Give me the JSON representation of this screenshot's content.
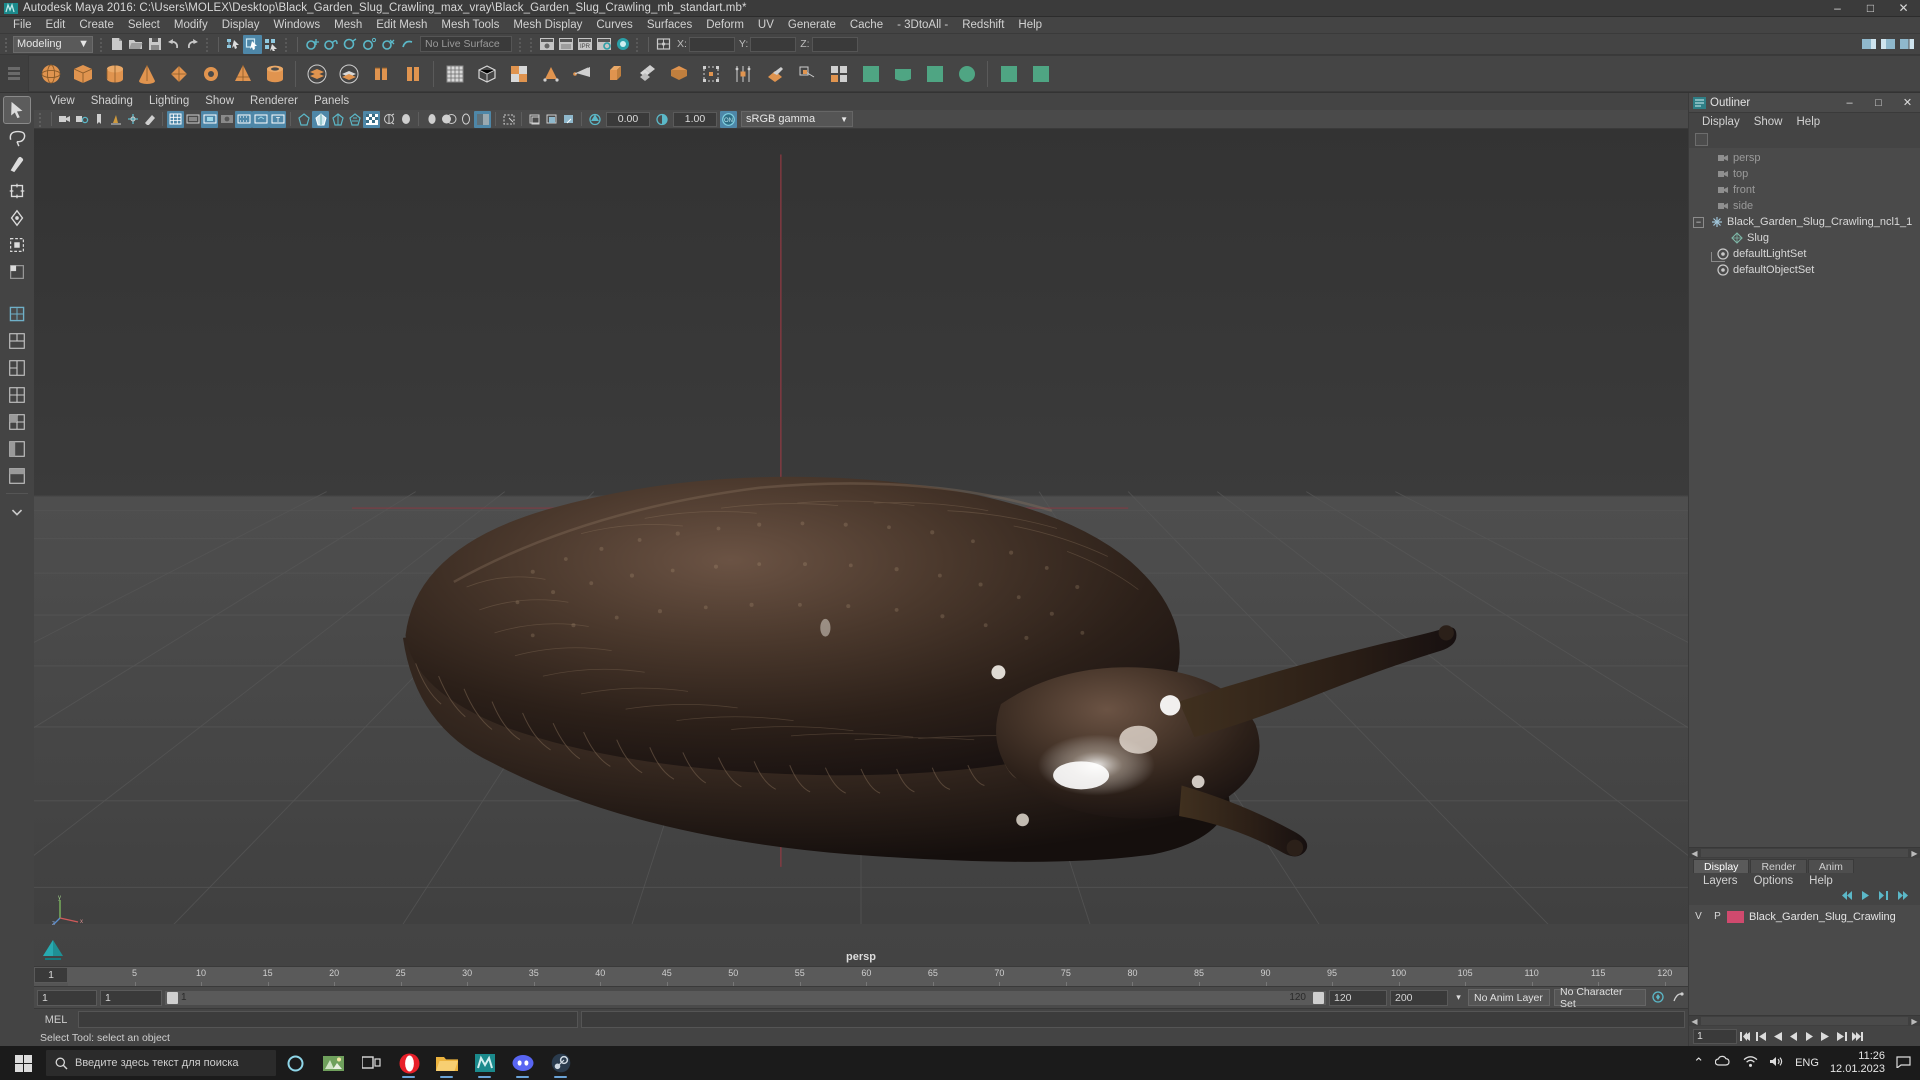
{
  "window": {
    "title": "Autodesk Maya 2016: C:\\Users\\MOLEX\\Desktop\\Black_Garden_Slug_Crawling_max_vray\\Black_Garden_Slug_Crawling_mb_standart.mb*",
    "app_icon": "maya-icon",
    "minimize": "–",
    "maximize": "□",
    "close": "✕"
  },
  "menubar": {
    "items": [
      "File",
      "Edit",
      "Create",
      "Select",
      "Modify",
      "Display",
      "Windows",
      "Mesh",
      "Edit Mesh",
      "Mesh Tools",
      "Mesh Display",
      "Curves",
      "Surfaces",
      "Deform",
      "UV",
      "Generate",
      "Cache",
      "- 3DtoAll -",
      "Redshift",
      "Help"
    ]
  },
  "statusline": {
    "mode": "Modeling",
    "mode_caret": "▼",
    "live_surface": "No Live Surface",
    "coord_x_label": "X:",
    "coord_y_label": "Y:",
    "coord_z_label": "Z:",
    "coord_x_value": "",
    "coord_y_value": "",
    "coord_z_value": "",
    "icons": [
      "new-scene-icon",
      "open-scene-icon",
      "save-scene-icon",
      "undo-icon",
      "redo-icon",
      "select-by-hierarchy-icon",
      "select-by-object-icon",
      "select-by-component-icon",
      "snap-to-grid-icon",
      "snap-to-curve-icon",
      "snap-to-point-icon",
      "snap-to-projected-center-icon",
      "snap-to-view-plane-icon",
      "make-live-icon",
      "show-render-view-icon",
      "render-current-frame-icon",
      "ipr-render-icon",
      "render-settings-icon",
      "hypershade-icon",
      "toggle-editors-icon"
    ]
  },
  "shelf": {
    "active_tab": "Polygons",
    "items": [
      "poly-sphere-icon",
      "poly-cube-icon",
      "poly-cylinder-icon",
      "poly-cone-icon",
      "poly-plane-icon",
      "poly-torus-icon",
      "poly-prism-icon",
      "poly-pipe-icon",
      "poly-helix-icon",
      "poly-soccer-ball-icon",
      "poly-platonic-icon",
      "poly-pyramid-icon",
      "combine-icon",
      "separate-icon",
      "booleans-icon",
      "smooth-icon",
      "mirror-icon",
      "extrude-icon",
      "bevel-icon",
      "bridge-icon",
      "append-polygon-icon",
      "wedge-icon",
      "duplicate-face-icon",
      "connect-icon",
      "detach-icon",
      "multi-cut-icon",
      "target-weld-icon",
      "quad-draw-icon",
      "sculpt-icon",
      "create-uvs-icon",
      "uv-editor-icon"
    ]
  },
  "toolbox": {
    "items": [
      {
        "name": "select-tool-icon",
        "selected": true
      },
      {
        "name": "lasso-select-tool-icon",
        "selected": false
      },
      {
        "name": "paint-select-tool-icon",
        "selected": false
      },
      {
        "name": "move-tool-icon",
        "selected": false
      },
      {
        "name": "rotate-tool-icon",
        "selected": false
      },
      {
        "name": "scale-tool-icon",
        "selected": false
      },
      {
        "name": "last-tool-icon",
        "selected": false
      },
      {
        "name": "single-pane-layout-icon",
        "selected": false
      },
      {
        "name": "two-pane-side-layout-icon",
        "selected": false
      },
      {
        "name": "two-pane-stacked-layout-icon",
        "selected": false
      },
      {
        "name": "three-pane-layout-icon",
        "selected": false
      },
      {
        "name": "four-pane-layout-icon",
        "selected": false
      },
      {
        "name": "persp-outliner-layout-icon",
        "selected": false
      },
      {
        "name": "hypershade-layout-icon",
        "selected": false
      },
      {
        "name": "more-layouts-icon",
        "selected": false
      }
    ]
  },
  "viewport": {
    "panel_menu": [
      "View",
      "Shading",
      "Lighting",
      "Show",
      "Renderer",
      "Panels"
    ],
    "camera_label": "persp",
    "toolbar": {
      "exposure_value": "0.00",
      "gamma_value": "1.00",
      "color_space": "sRGB gamma",
      "color_space_caret": "▼",
      "color_toggle": "ON",
      "icons": [
        "select-camera-icon",
        "camera-attributes-icon",
        "bookmarks-icon",
        "image-plane-icon",
        "two-d-pan-zoom-icon",
        "grease-pencil-icon",
        "grid-icon",
        "film-gate-icon",
        "resolution-gate-icon",
        "gate-mask-icon",
        "film-origin-icon",
        "safe-action-icon",
        "field-chart-icon",
        "wireframe-icon",
        "smooth-shade-icon",
        "shaded-wireframe-icon",
        "textured-icon",
        "use-default-lighting-icon",
        "shadows-icon",
        "ambient-occlusion-icon",
        "motion-blur-icon",
        "multisample-icon",
        "depth-of-field-icon",
        "isolate-select-icon",
        "xray-icon",
        "xray-joints-icon",
        "xray-active-components-icon",
        "exposure-icon",
        "gamma-icon"
      ]
    },
    "axis_labels": {
      "y": "y",
      "x": "x",
      "z": "z"
    }
  },
  "outliner": {
    "title": "Outliner",
    "title_icon": "outliner-icon",
    "minimize": "–",
    "maximize": "□",
    "close": "✕",
    "menu": [
      "Display",
      "Show",
      "Help"
    ],
    "items": [
      {
        "label": "persp",
        "icon": "camera-icon",
        "indent": 24,
        "dim": true,
        "expander": false
      },
      {
        "label": "top",
        "icon": "camera-icon",
        "indent": 24,
        "dim": true,
        "expander": false
      },
      {
        "label": "front",
        "icon": "camera-icon",
        "indent": 24,
        "dim": true,
        "expander": false
      },
      {
        "label": "side",
        "icon": "camera-icon",
        "indent": 24,
        "dim": true,
        "expander": false
      },
      {
        "label": "Black_Garden_Slug_Crawling_ncl1_1",
        "icon": "transform-icon",
        "indent": 4,
        "dim": false,
        "expander": true
      },
      {
        "label": "Slug",
        "icon": "mesh-icon",
        "indent": 38,
        "dim": false,
        "expander": false
      },
      {
        "label": "defaultLightSet",
        "icon": "set-icon",
        "indent": 24,
        "dim": false,
        "expander": false
      },
      {
        "label": "defaultObjectSet",
        "icon": "set-icon",
        "indent": 24,
        "dim": false,
        "expander": false
      }
    ]
  },
  "channel_tabs": {
    "items": [
      {
        "label": "Display",
        "active": true
      },
      {
        "label": "Render",
        "active": false
      },
      {
        "label": "Anim",
        "active": false
      }
    ]
  },
  "layers": {
    "menu": [
      "Layers",
      "Options",
      "Help"
    ],
    "buttons": [
      "layer-prev-icon",
      "layer-play-icon",
      "layer-next-icon",
      "layer-end-icon"
    ],
    "columns": {
      "visibility": "V",
      "playback": "P"
    },
    "rows": [
      {
        "v": "V",
        "p": "P",
        "color": "#d04a6e",
        "name": "Black_Garden_Slug_Crawling"
      }
    ]
  },
  "timeline": {
    "ticks": [
      "5",
      "10",
      "15",
      "20",
      "25",
      "30",
      "35",
      "40",
      "45",
      "50",
      "55",
      "60",
      "65",
      "70",
      "75",
      "80",
      "85",
      "90",
      "95",
      "100",
      "105",
      "110",
      "115",
      "120"
    ],
    "current_frame_left": "1",
    "start_frame": "1",
    "playback_start": "1",
    "range_start_label": "1",
    "range_end_label": "120",
    "end_frame": "120",
    "playback_end": "200",
    "anim_layer": "No Anim Layer",
    "character_set": "No Character Set",
    "playhead_frame": "1",
    "transport": [
      "go-to-start-icon",
      "step-back-keyframe-icon",
      "step-back-frame-icon",
      "play-backwards-icon",
      "play-forwards-icon",
      "step-forward-frame-icon",
      "step-forward-keyframe-icon",
      "go-to-end-icon"
    ],
    "extra_icons": [
      "auto-keyframe-icon",
      "animation-preferences-icon"
    ]
  },
  "command": {
    "mel_label": "MEL",
    "mel_input_value": "",
    "help_line": "Select Tool: select an object"
  },
  "taskbar": {
    "start_icon": "windows-start-icon",
    "search_placeholder": "Введите здесь текст для поиска",
    "search_icon": "search-icon",
    "apps": [
      "cortana-circle-icon",
      "photos-icon",
      "task-view-icon",
      "opera-icon",
      "file-explorer-icon",
      "maya-taskbar-icon",
      "discord-icon",
      "steam-icon"
    ],
    "tray": {
      "chevron": "⌃",
      "onedrive_icon": "onedrive-icon",
      "network_icon": "network-icon",
      "volume_icon": "volume-icon",
      "language": "ENG",
      "time": "11:26",
      "date": "12.01.2023",
      "notification_icon": "notification-icon"
    }
  },
  "colors": {
    "accent_blue": "#4e87a8",
    "shelf_orange": "#e0944f",
    "layer_pink": "#d04a6e",
    "panel_bg": "#444444",
    "viewport_top": "#3a3a3a",
    "grid_line": "#555555"
  }
}
